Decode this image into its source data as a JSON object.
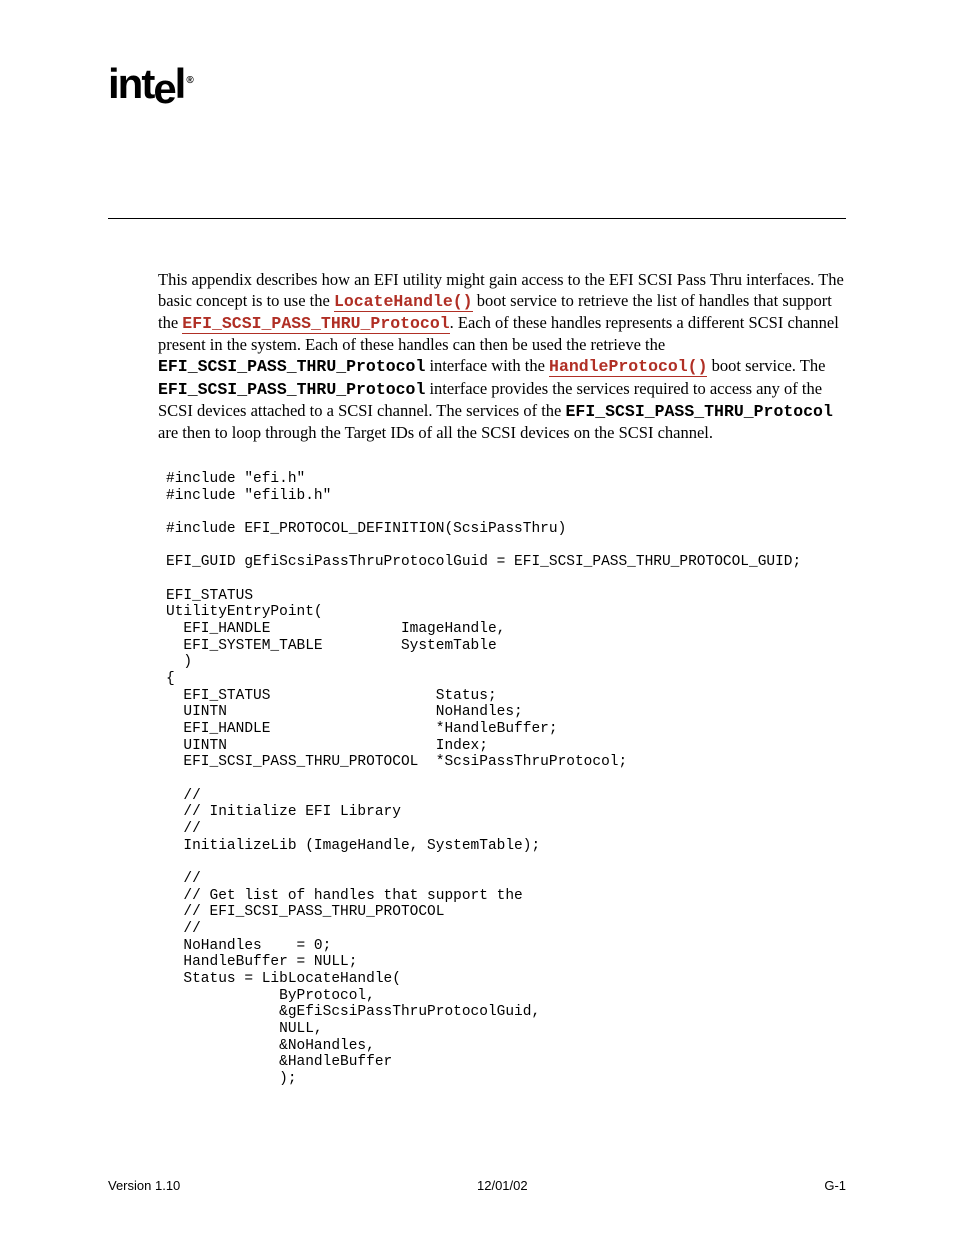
{
  "logo": "intel",
  "para": {
    "t1": "This appendix describes how an EFI utility might gain access to the EFI SCSI Pass Thru interfaces. The basic concept is to use the ",
    "link1": "LocateHandle()",
    "t2": " boot service to retrieve the list of handles that support the ",
    "link2": "EFI_SCSI_PASS_THRU_Protocol",
    "t3": ".  Each of these handles represents a different SCSI channel present in the system.  Each of these handles can then be used the retrieve the ",
    "mono1": "EFI_SCSI_PASS_THRU_Protocol",
    "t4": " interface with the ",
    "link3": "HandleProtocol()",
    "t5": " boot service. The ",
    "mono2": "EFI_SCSI_PASS_THRU_Protocol",
    "t6": " interface provides the services required to access any of the SCSI devices attached to a SCSI channel.  The services of the ",
    "mono3": "EFI_SCSI_PASS_THRU_Protocol",
    "t7": " are then to loop through the Target IDs of all the SCSI devices on the SCSI channel."
  },
  "code": "#include \"efi.h\"\n#include \"efilib.h\"\n\n#include EFI_PROTOCOL_DEFINITION(ScsiPassThru)\n\nEFI_GUID gEfiScsiPassThruProtocolGuid = EFI_SCSI_PASS_THRU_PROTOCOL_GUID;\n\nEFI_STATUS\nUtilityEntryPoint(\n  EFI_HANDLE               ImageHandle,\n  EFI_SYSTEM_TABLE         SystemTable\n  )\n{\n  EFI_STATUS                   Status;\n  UINTN                        NoHandles;\n  EFI_HANDLE                   *HandleBuffer;\n  UINTN                        Index;\n  EFI_SCSI_PASS_THRU_PROTOCOL  *ScsiPassThruProtocol;\n\n  //\n  // Initialize EFI Library\n  //\n  InitializeLib (ImageHandle, SystemTable);\n\n  //\n  // Get list of handles that support the\n  // EFI_SCSI_PASS_THRU_PROTOCOL\n  //\n  NoHandles    = 0;\n  HandleBuffer = NULL;\n  Status = LibLocateHandle(\n             ByProtocol,\n             &gEfiScsiPassThruProtocolGuid,\n             NULL,\n             &NoHandles,\n             &HandleBuffer\n             );",
  "footer": {
    "left": "Version 1.10",
    "center": "12/01/02",
    "right": "G-1"
  }
}
